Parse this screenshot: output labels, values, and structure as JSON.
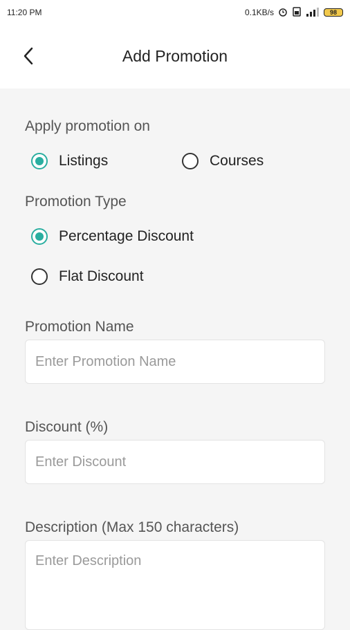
{
  "status_bar": {
    "time": "11:20 PM",
    "network_speed": "0.1KB/s",
    "battery": "98"
  },
  "header": {
    "title": "Add Promotion"
  },
  "apply_on": {
    "label": "Apply promotion on",
    "options": [
      {
        "label": "Listings",
        "selected": true
      },
      {
        "label": "Courses",
        "selected": false
      }
    ]
  },
  "promotion_type": {
    "label": "Promotion Type",
    "options": [
      {
        "label": "Percentage Discount",
        "selected": true
      },
      {
        "label": "Flat Discount",
        "selected": false
      }
    ]
  },
  "promotion_name": {
    "label": "Promotion Name",
    "placeholder": "Enter Promotion Name"
  },
  "discount": {
    "label": "Discount (%)",
    "placeholder": "Enter Discount"
  },
  "description": {
    "label": "Description (Max 150 characters)",
    "placeholder": "Enter Description"
  },
  "colors": {
    "accent": "#2aaea0",
    "background": "#f5f5f5",
    "header_bg": "#ffffff"
  }
}
